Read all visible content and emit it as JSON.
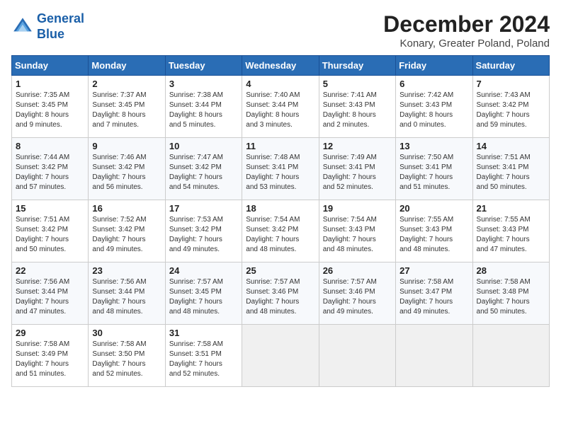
{
  "header": {
    "logo_line1": "General",
    "logo_line2": "Blue",
    "month_title": "December 2024",
    "location": "Konary, Greater Poland, Poland"
  },
  "weekdays": [
    "Sunday",
    "Monday",
    "Tuesday",
    "Wednesday",
    "Thursday",
    "Friday",
    "Saturday"
  ],
  "weeks": [
    [
      {
        "day": "1",
        "info": "Sunrise: 7:35 AM\nSunset: 3:45 PM\nDaylight: 8 hours\nand 9 minutes."
      },
      {
        "day": "2",
        "info": "Sunrise: 7:37 AM\nSunset: 3:45 PM\nDaylight: 8 hours\nand 7 minutes."
      },
      {
        "day": "3",
        "info": "Sunrise: 7:38 AM\nSunset: 3:44 PM\nDaylight: 8 hours\nand 5 minutes."
      },
      {
        "day": "4",
        "info": "Sunrise: 7:40 AM\nSunset: 3:44 PM\nDaylight: 8 hours\nand 3 minutes."
      },
      {
        "day": "5",
        "info": "Sunrise: 7:41 AM\nSunset: 3:43 PM\nDaylight: 8 hours\nand 2 minutes."
      },
      {
        "day": "6",
        "info": "Sunrise: 7:42 AM\nSunset: 3:43 PM\nDaylight: 8 hours\nand 0 minutes."
      },
      {
        "day": "7",
        "info": "Sunrise: 7:43 AM\nSunset: 3:42 PM\nDaylight: 7 hours\nand 59 minutes."
      }
    ],
    [
      {
        "day": "8",
        "info": "Sunrise: 7:44 AM\nSunset: 3:42 PM\nDaylight: 7 hours\nand 57 minutes."
      },
      {
        "day": "9",
        "info": "Sunrise: 7:46 AM\nSunset: 3:42 PM\nDaylight: 7 hours\nand 56 minutes."
      },
      {
        "day": "10",
        "info": "Sunrise: 7:47 AM\nSunset: 3:42 PM\nDaylight: 7 hours\nand 54 minutes."
      },
      {
        "day": "11",
        "info": "Sunrise: 7:48 AM\nSunset: 3:41 PM\nDaylight: 7 hours\nand 53 minutes."
      },
      {
        "day": "12",
        "info": "Sunrise: 7:49 AM\nSunset: 3:41 PM\nDaylight: 7 hours\nand 52 minutes."
      },
      {
        "day": "13",
        "info": "Sunrise: 7:50 AM\nSunset: 3:41 PM\nDaylight: 7 hours\nand 51 minutes."
      },
      {
        "day": "14",
        "info": "Sunrise: 7:51 AM\nSunset: 3:41 PM\nDaylight: 7 hours\nand 50 minutes."
      }
    ],
    [
      {
        "day": "15",
        "info": "Sunrise: 7:51 AM\nSunset: 3:42 PM\nDaylight: 7 hours\nand 50 minutes."
      },
      {
        "day": "16",
        "info": "Sunrise: 7:52 AM\nSunset: 3:42 PM\nDaylight: 7 hours\nand 49 minutes."
      },
      {
        "day": "17",
        "info": "Sunrise: 7:53 AM\nSunset: 3:42 PM\nDaylight: 7 hours\nand 49 minutes."
      },
      {
        "day": "18",
        "info": "Sunrise: 7:54 AM\nSunset: 3:42 PM\nDaylight: 7 hours\nand 48 minutes."
      },
      {
        "day": "19",
        "info": "Sunrise: 7:54 AM\nSunset: 3:43 PM\nDaylight: 7 hours\nand 48 minutes."
      },
      {
        "day": "20",
        "info": "Sunrise: 7:55 AM\nSunset: 3:43 PM\nDaylight: 7 hours\nand 48 minutes."
      },
      {
        "day": "21",
        "info": "Sunrise: 7:55 AM\nSunset: 3:43 PM\nDaylight: 7 hours\nand 47 minutes."
      }
    ],
    [
      {
        "day": "22",
        "info": "Sunrise: 7:56 AM\nSunset: 3:44 PM\nDaylight: 7 hours\nand 47 minutes."
      },
      {
        "day": "23",
        "info": "Sunrise: 7:56 AM\nSunset: 3:44 PM\nDaylight: 7 hours\nand 48 minutes."
      },
      {
        "day": "24",
        "info": "Sunrise: 7:57 AM\nSunset: 3:45 PM\nDaylight: 7 hours\nand 48 minutes."
      },
      {
        "day": "25",
        "info": "Sunrise: 7:57 AM\nSunset: 3:46 PM\nDaylight: 7 hours\nand 48 minutes."
      },
      {
        "day": "26",
        "info": "Sunrise: 7:57 AM\nSunset: 3:46 PM\nDaylight: 7 hours\nand 49 minutes."
      },
      {
        "day": "27",
        "info": "Sunrise: 7:58 AM\nSunset: 3:47 PM\nDaylight: 7 hours\nand 49 minutes."
      },
      {
        "day": "28",
        "info": "Sunrise: 7:58 AM\nSunset: 3:48 PM\nDaylight: 7 hours\nand 50 minutes."
      }
    ],
    [
      {
        "day": "29",
        "info": "Sunrise: 7:58 AM\nSunset: 3:49 PM\nDaylight: 7 hours\nand 51 minutes."
      },
      {
        "day": "30",
        "info": "Sunrise: 7:58 AM\nSunset: 3:50 PM\nDaylight: 7 hours\nand 52 minutes."
      },
      {
        "day": "31",
        "info": "Sunrise: 7:58 AM\nSunset: 3:51 PM\nDaylight: 7 hours\nand 52 minutes."
      },
      null,
      null,
      null,
      null
    ]
  ]
}
